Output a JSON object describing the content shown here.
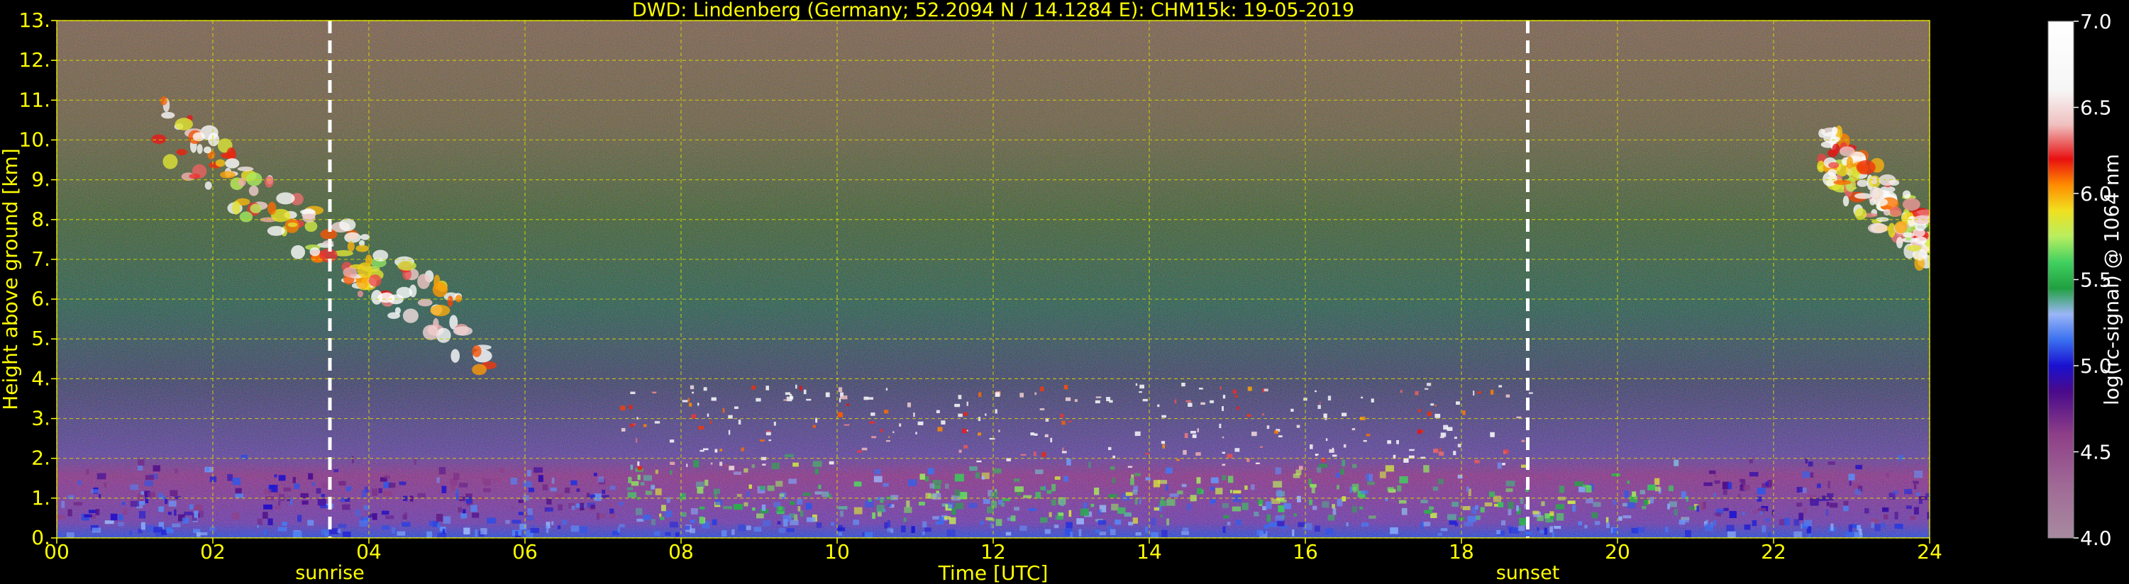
{
  "chart_data": {
    "type": "heatmap",
    "title": "DWD: Lindenberg (Germany; 52.2094 N / 14.1284 E):    CHM15k: 19-05-2019",
    "xlabel": "Time [UTC]",
    "ylabel": "Height above ground [km]",
    "xlim": [
      0,
      24
    ],
    "ylim": [
      0,
      13
    ],
    "x_ticks": [
      0,
      2,
      4,
      6,
      8,
      10,
      12,
      14,
      16,
      18,
      20,
      22,
      24
    ],
    "x_tick_labels": [
      "00",
      "02",
      "04",
      "06",
      "08",
      "10",
      "12",
      "14",
      "16",
      "18",
      "20",
      "22",
      "24"
    ],
    "y_ticks": [
      0,
      1,
      2,
      3,
      4,
      5,
      6,
      7,
      8,
      9,
      10,
      11,
      12,
      13
    ],
    "y_tick_labels": [
      "0.",
      "1.",
      "2.",
      "3.",
      "4.",
      "5.",
      "6.",
      "7.",
      "8.",
      "9.",
      "10.",
      "11.",
      "12.",
      "13."
    ],
    "grid": true,
    "colorbar": {
      "label": "log(rc-signal) @ 1064 nm",
      "range": [
        4.0,
        7.0
      ],
      "ticks": [
        4.0,
        4.5,
        5.0,
        5.5,
        6.0,
        6.5,
        7.0
      ],
      "tick_labels": [
        "4.0",
        "4.5",
        "5.0",
        "5.5",
        "6.0",
        "6.5",
        "7.0"
      ],
      "stops": [
        {
          "v": 4.0,
          "c": "#a88aa0"
        },
        {
          "v": 4.3,
          "c": "#a06a96"
        },
        {
          "v": 4.6,
          "c": "#8e3f88"
        },
        {
          "v": 4.85,
          "c": "#4a0a8a"
        },
        {
          "v": 5.0,
          "c": "#1a10d0"
        },
        {
          "v": 5.15,
          "c": "#3a70f0"
        },
        {
          "v": 5.3,
          "c": "#9ab6f6"
        },
        {
          "v": 5.45,
          "c": "#20a040"
        },
        {
          "v": 5.6,
          "c": "#40d060"
        },
        {
          "v": 5.75,
          "c": "#b8ee60"
        },
        {
          "v": 5.9,
          "c": "#f0e020"
        },
        {
          "v": 6.05,
          "c": "#ff8c00"
        },
        {
          "v": 6.2,
          "c": "#e81010"
        },
        {
          "v": 6.4,
          "c": "#f0c0c0"
        },
        {
          "v": 6.6,
          "c": "#f6f6f6"
        },
        {
          "v": 7.0,
          "c": "#ffffff"
        }
      ]
    },
    "annotations": [
      {
        "label": "sunrise",
        "x": 3.5,
        "line": "white-dashed"
      },
      {
        "label": "sunset",
        "x": 18.85,
        "line": "white-dashed"
      }
    ],
    "features": [
      {
        "kind": "boundary-layer",
        "x": [
          0,
          24
        ],
        "y": [
          0,
          2.0
        ]
      },
      {
        "kind": "cirrus",
        "x": [
          1.3,
          5.6
        ],
        "y": [
          4.7,
          10.3
        ]
      },
      {
        "kind": "cirrus",
        "x": [
          22.6,
          24
        ],
        "y": [
          7.2,
          9.8
        ]
      },
      {
        "kind": "cumulus-tops",
        "x": [
          7.2,
          18.9
        ],
        "y": [
          1.8,
          3.9
        ]
      }
    ],
    "colors": {
      "background": "#000000",
      "text": "#ffff00",
      "colorbar_text": "#ffffff",
      "grid": "#d8d800",
      "marker_line": "#ffffff"
    }
  }
}
